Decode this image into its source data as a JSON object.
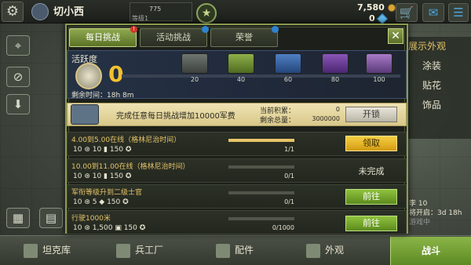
{
  "topbar": {
    "player_name": "切小西",
    "level_value": "775",
    "level_sub": "等级1",
    "currency_coins": "7,580",
    "currency_gems": "0"
  },
  "right_menu": {
    "title": "展示外观",
    "items": [
      "涂装",
      "贴花",
      "饰品"
    ]
  },
  "right_info": {
    "line1": "李 10",
    "line2": "将开启：3d 18h",
    "line3": "游戏中"
  },
  "bottom_nav": {
    "items": [
      "坦克库",
      "兵工厂",
      "配件",
      "外观"
    ],
    "battle_label": "战斗"
  },
  "dialog": {
    "tabs": [
      {
        "label": "每日挑战",
        "active": true
      },
      {
        "label": "活动挑战",
        "active": false
      },
      {
        "label": "荣誉",
        "active": false
      }
    ],
    "tab_dots": [
      "!",
      "🔒",
      "🔒"
    ],
    "close_label": "✕"
  },
  "activity": {
    "label": "活跃度",
    "value": "0",
    "time_label": "剩余时间：18h 8m",
    "milestones": [
      "20",
      "40",
      "60",
      "80",
      "100"
    ]
  },
  "bonus": {
    "text": "完成任意每日挑战增加10000军费",
    "current_label": "当前积累：",
    "current_value": "0",
    "remaining_label": "剩余总量：",
    "remaining_value": "3000000",
    "unlock_label": "开锁"
  },
  "tasks": [
    {
      "title": "4.00到5.00在线（格林尼治时间）",
      "rewards": "10 ⊛ 10 ▮ 150 ✪",
      "progress": 1.0,
      "count": "1/1",
      "action": "领取",
      "action_type": "claim"
    },
    {
      "title": "10.00到11.00在线（格林尼治时间）",
      "rewards": "10 ⊛ 10 ▮ 150 ✪",
      "progress": 0.0,
      "count": "0/1",
      "action": "未完成",
      "action_type": "status"
    },
    {
      "title": "军衔等级升到二级士官",
      "rewards": "10 ⊛ 5 ◆ 150 ✪",
      "progress": 0.0,
      "count": "0/1",
      "action": "前往",
      "action_type": "go"
    },
    {
      "title": "行驶1000米",
      "rewards": "10 ⊛ 1,500 ▣ 150 ✪",
      "progress": 0.0,
      "count": "0/1000",
      "action": "前往",
      "action_type": "go"
    }
  ],
  "colors": {
    "accent_green": "#8fa950",
    "gold": "#e6c468",
    "activity_value": "#f1c12f"
  }
}
